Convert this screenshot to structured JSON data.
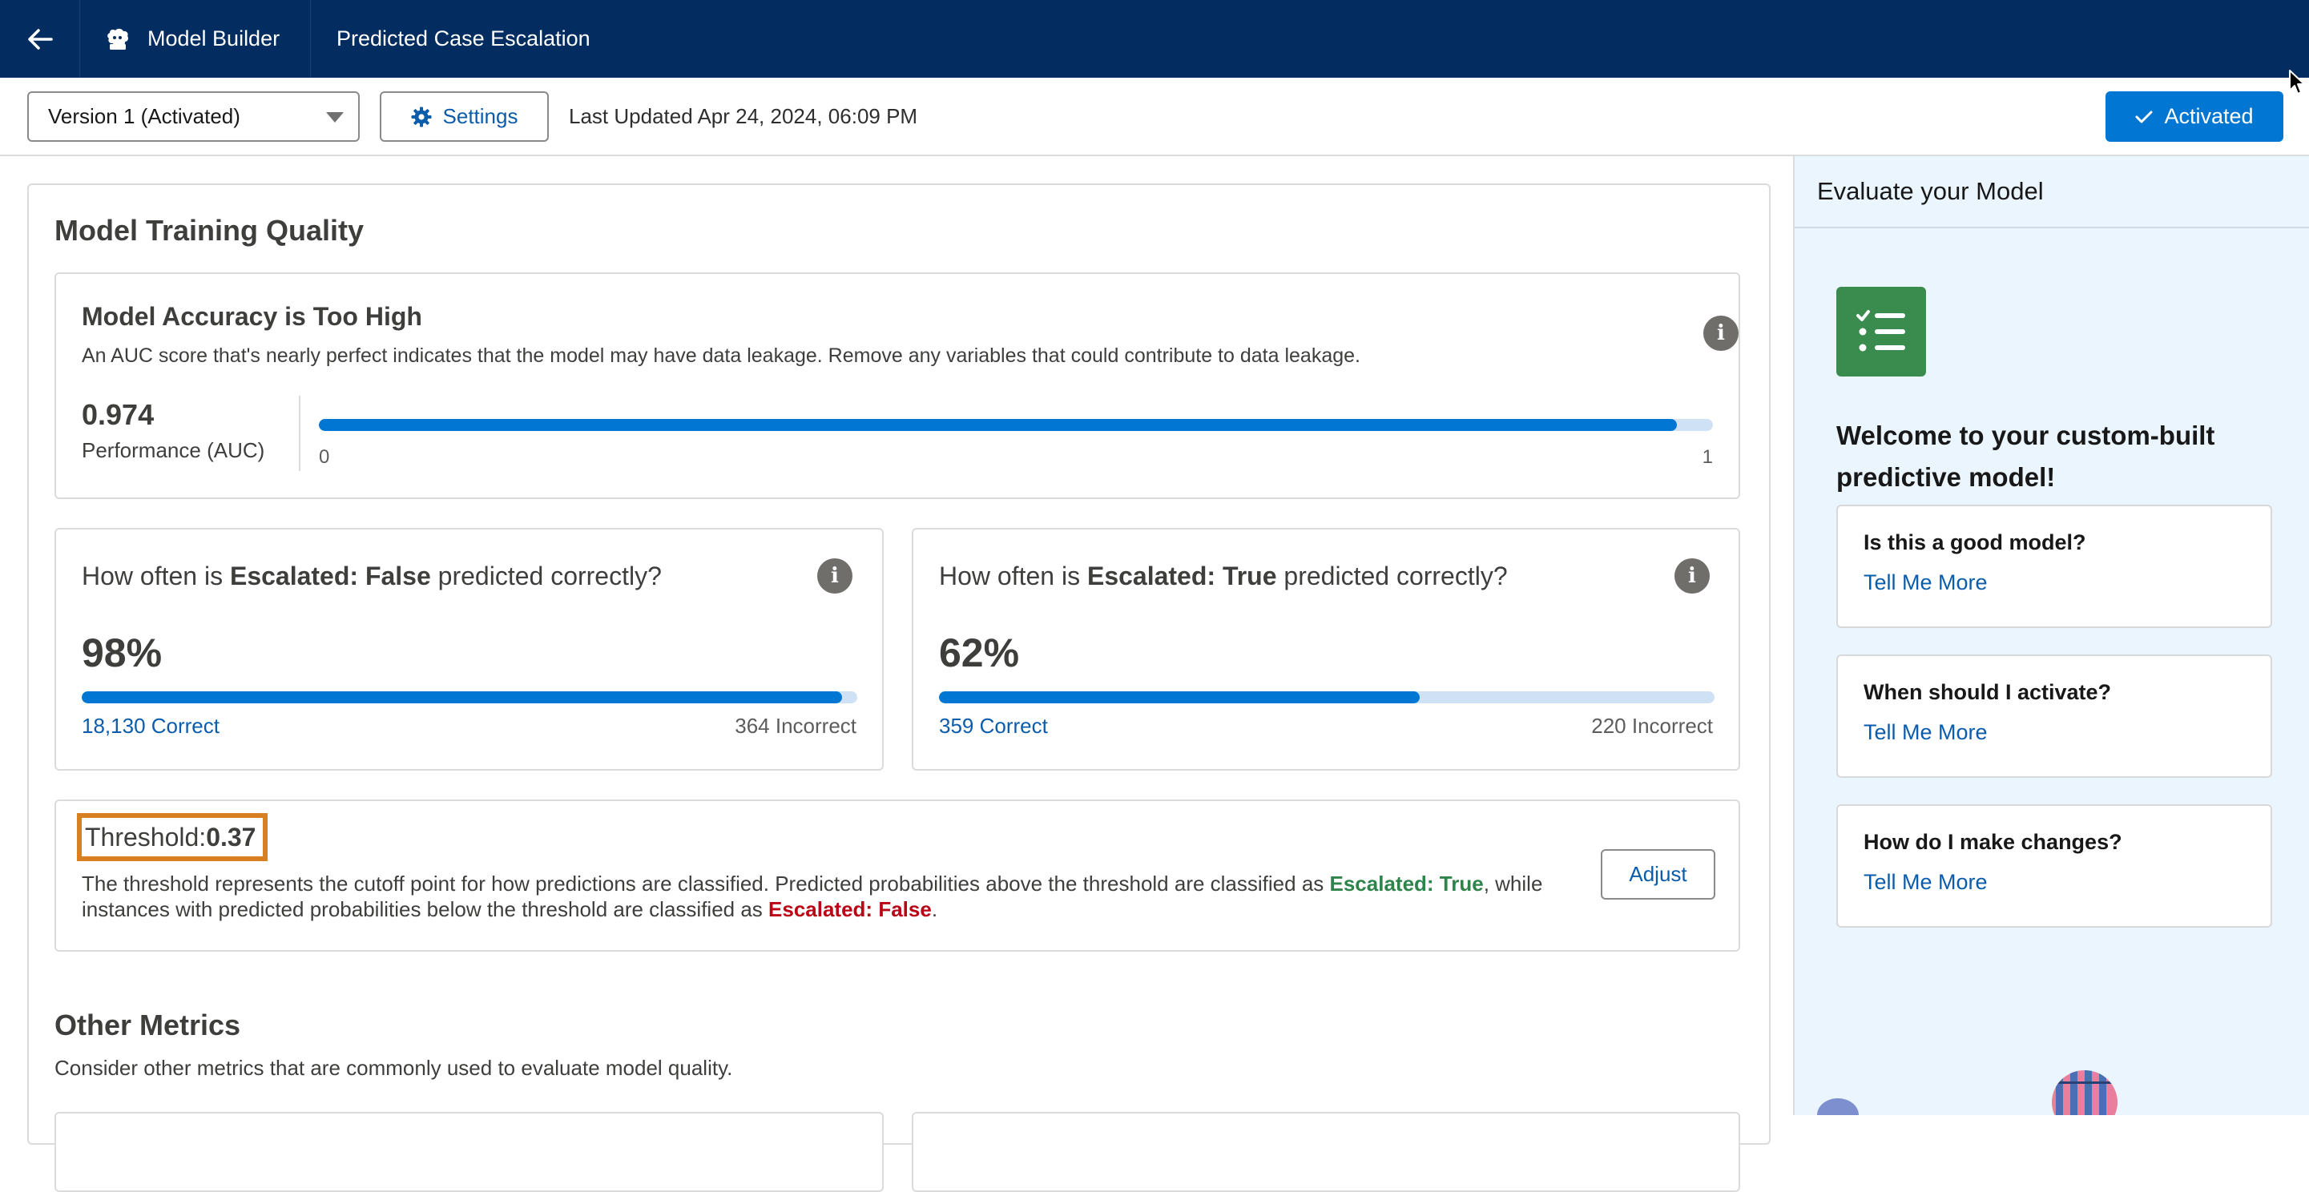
{
  "header": {
    "app_name": "Model Builder",
    "page_title": "Predicted Case Escalation"
  },
  "toolbar": {
    "version_value": "Version 1 (Activated)",
    "settings_label": "Settings",
    "last_updated": "Last Updated Apr 24, 2024, 06:09 PM",
    "activated_label": "Activated"
  },
  "main": {
    "section_title": "Model Training Quality",
    "accuracy": {
      "title": "Model Accuracy is Too High",
      "description": "An AUC score that's nearly perfect indicates that the model may have data leakage. Remove any variables that could contribute to data leakage.",
      "auc_value": "0.974",
      "auc_fraction": 0.974,
      "auc_label": "Performance (AUC)",
      "axis_min": "0",
      "axis_max": "1"
    },
    "false_card": {
      "q_prefix": "How often is ",
      "q_bold": "Escalated: False",
      "q_suffix": " predicted correctly?",
      "percent": "98%",
      "fraction": 0.98,
      "correct": "18,130 Correct",
      "incorrect": "364 Incorrect"
    },
    "true_card": {
      "q_prefix": "How often is ",
      "q_bold": "Escalated: True",
      "q_suffix": " predicted correctly?",
      "percent": "62%",
      "fraction": 0.62,
      "correct": "359 Correct",
      "incorrect": "220 Incorrect"
    },
    "threshold": {
      "label": "Threshold: ",
      "value": "0.37",
      "desc_part1": "The threshold represents the cutoff point for how predictions are classified. Predicted probabilities above the threshold are classified as ",
      "true_term": "Escalated: True",
      "desc_part2": ", while instances with predicted probabilities below the threshold are classified as ",
      "false_term": "Escalated: False",
      "desc_part3": ".",
      "adjust_label": "Adjust"
    },
    "other_metrics": {
      "title": "Other Metrics",
      "description": "Consider other metrics that are commonly used to evaluate model quality."
    }
  },
  "right_panel": {
    "title": "Evaluate your Model",
    "welcome": "Welcome to your custom-built predictive model!",
    "faqs": [
      {
        "question": "Is this a good model?",
        "link": "Tell Me More"
      },
      {
        "question": "When should I activate?",
        "link": "Tell Me More"
      },
      {
        "question": "How do I make changes?",
        "link": "Tell Me More"
      }
    ]
  },
  "colors": {
    "header_bg": "#032d60",
    "brand_blue": "#0176d3",
    "link_blue": "#0b5cab",
    "highlight_orange": "#d8801f",
    "true_green": "#2e844a",
    "false_red": "#ba0517",
    "right_panel_bg": "#eaf5fe"
  },
  "icons": {
    "back": "arrow-left-icon",
    "app": "model-builder-icon",
    "settings": "gear-icon",
    "activated": "check-icon",
    "info": "info-icon",
    "rp": "checklist-icon"
  }
}
